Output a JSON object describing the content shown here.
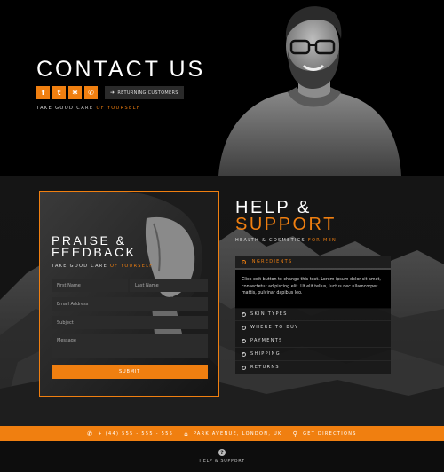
{
  "hero": {
    "title": "CONTACT US",
    "social_icons": [
      "facebook-icon",
      "twitter-icon",
      "yelp-icon",
      "whatsapp-icon"
    ],
    "social_glyphs": [
      "f",
      "t",
      "✱",
      "✆"
    ],
    "returning_label": "RETURNING CUSTOMERS",
    "tagline_plain": "TAKE GOOD CARE ",
    "tagline_accent": "OF YOURSELF"
  },
  "feedback": {
    "title_line1": "PRAISE &",
    "title_line2": "FEEDBACK",
    "tagline_plain": "TAKE GOOD CARE ",
    "tagline_accent": "OF YOURSELF",
    "fields": {
      "first_name": "First Name",
      "last_name": "Last Name",
      "email": "Email Address",
      "subject": "Subject",
      "message": "Message"
    },
    "submit_label": "SUBMIT"
  },
  "help": {
    "title_line1": "HELP &",
    "title_line2": "SUPPORT",
    "tagline_plain": "HEALTH & COSMETICS ",
    "tagline_accent": "FOR MEN",
    "open_item": {
      "label": "INGREDIENTS",
      "body": "Click edit button to change this text. Lorem ipsum dolor sit amet, consectetur adipiscing elit. Ut elit tellus, luctus nec ullamcorper mattis, pulvinar dapibus leo."
    },
    "items": [
      "SKIN TYPES",
      "WHERE TO BUY",
      "PAYMENTS",
      "SHIPPING",
      "RETURNS"
    ]
  },
  "contact_strip": {
    "phone": "+ (44) 555 - 555 - 555",
    "address": "PARK AVENUE, LONDON, UK",
    "directions": "GET DIRECTIONS"
  },
  "footer": {
    "label": "HELP & SUPPORT"
  },
  "colors": {
    "accent": "#f07f10",
    "background": "#000000"
  }
}
